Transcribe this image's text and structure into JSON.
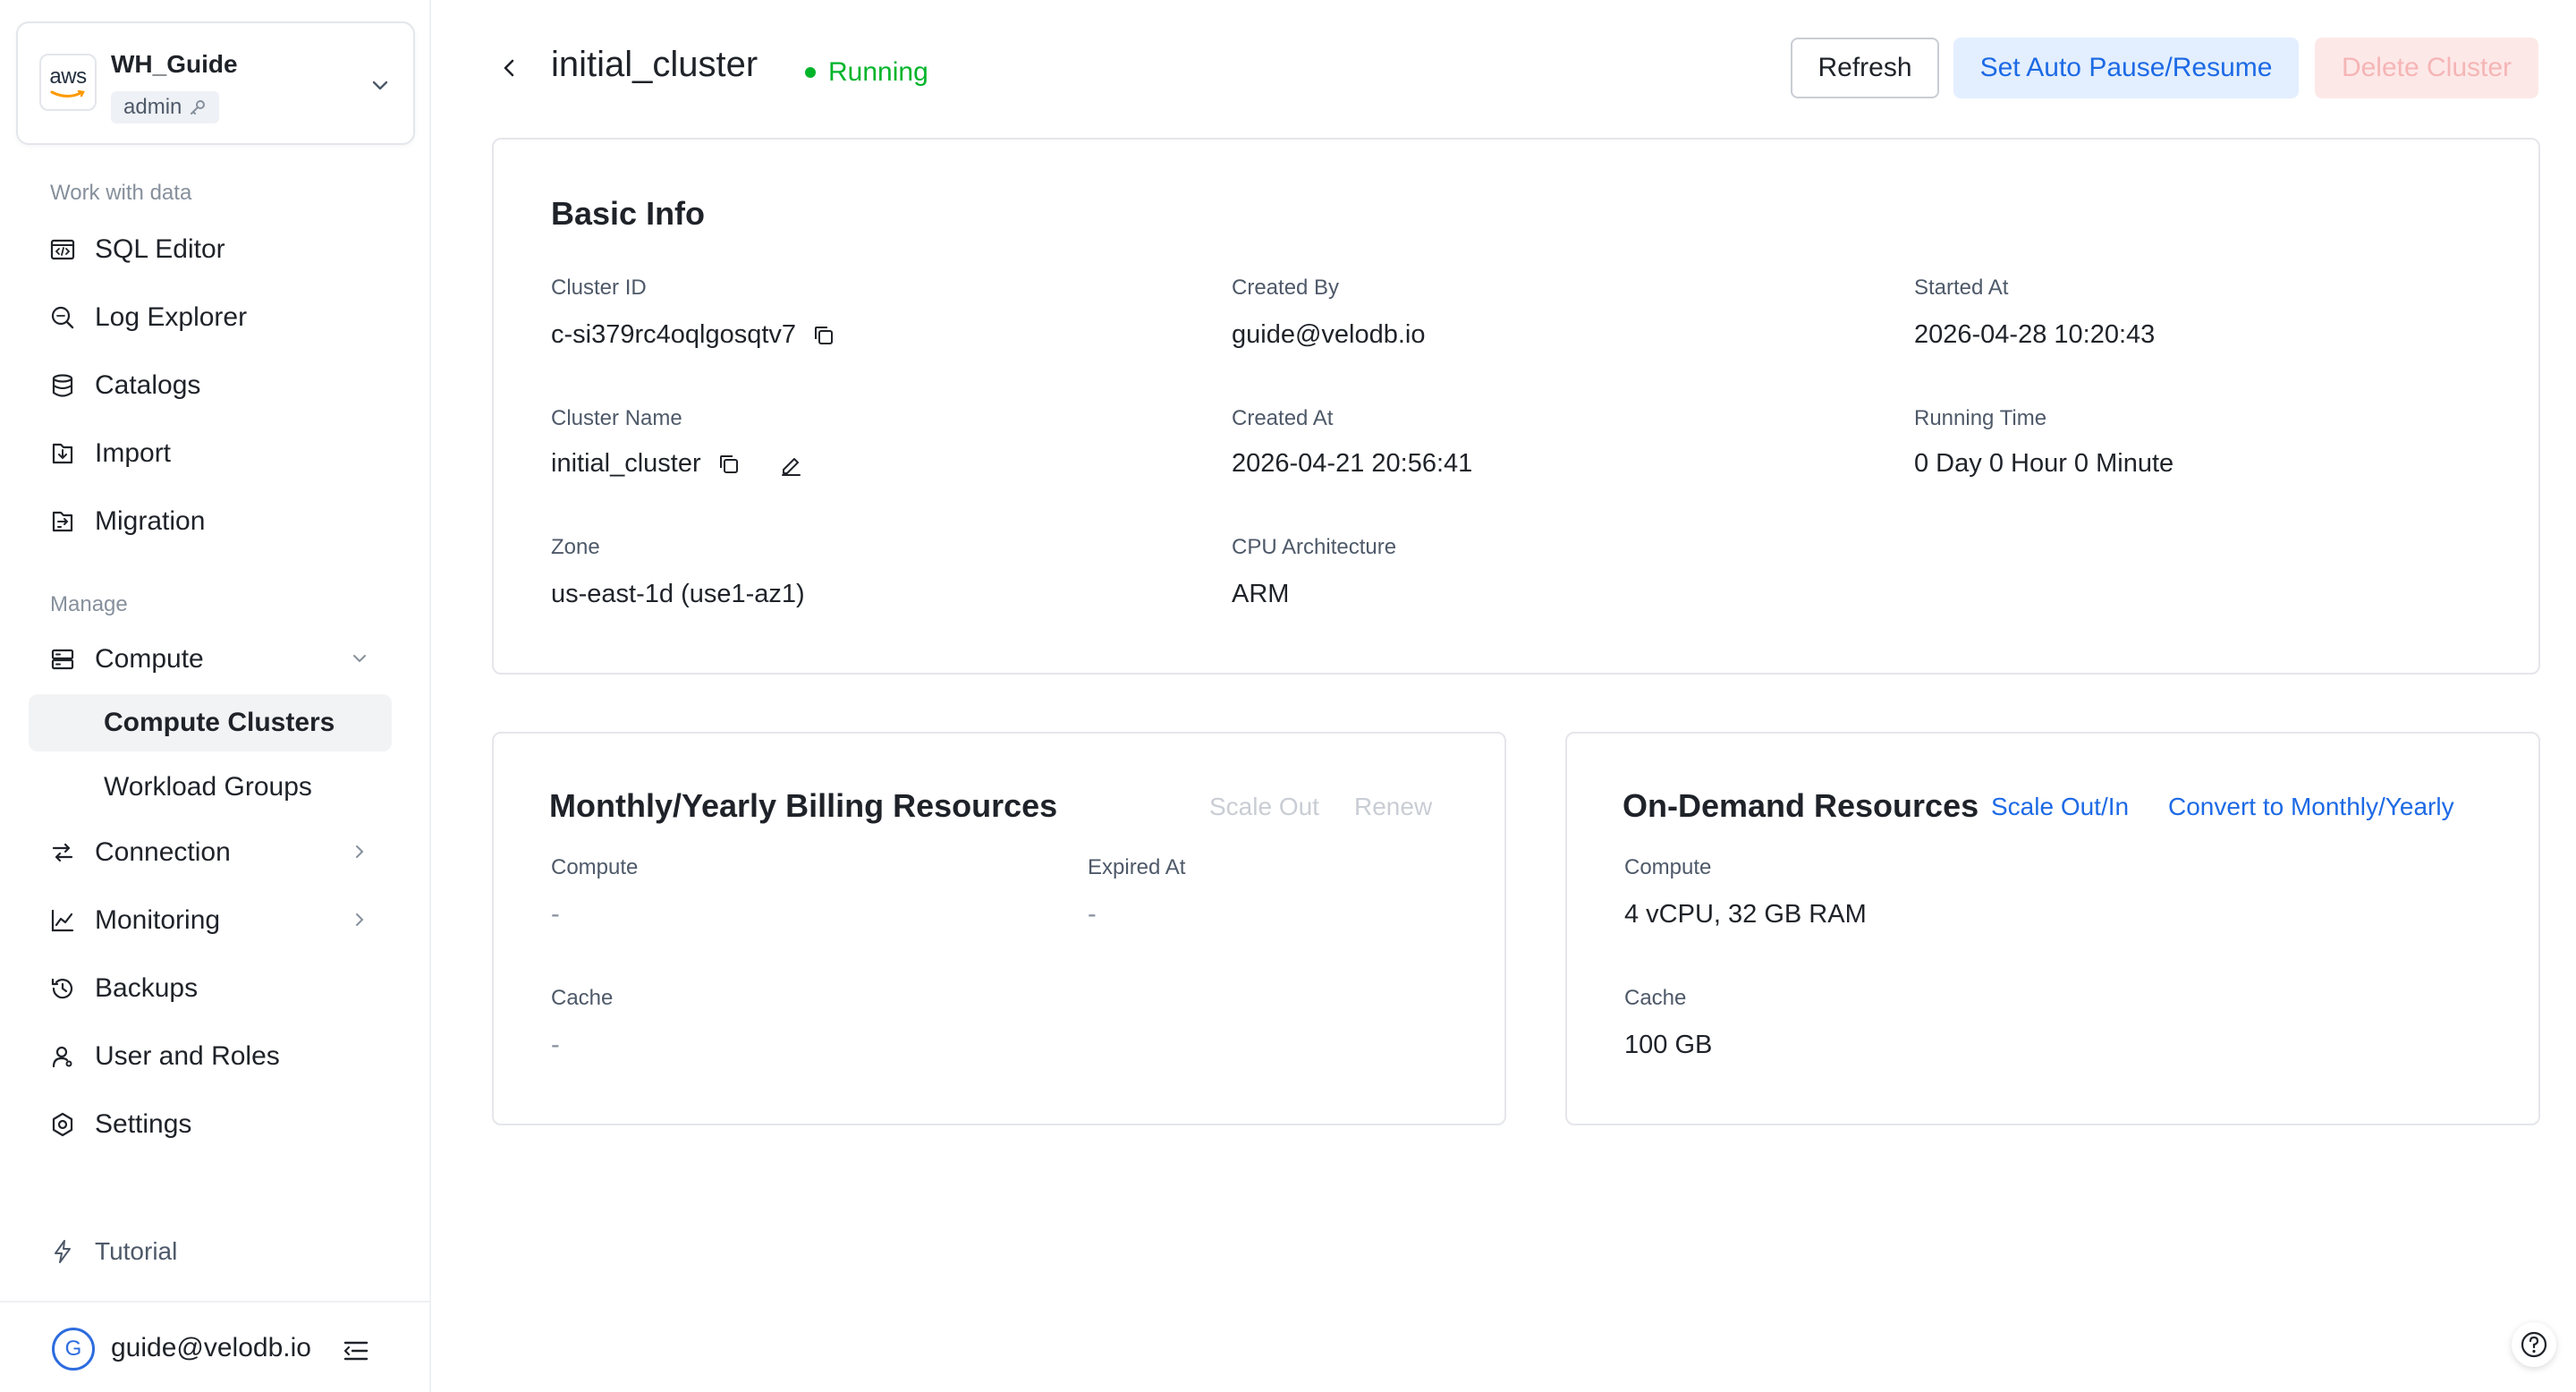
{
  "workspace": {
    "logo_text": "aws",
    "name": "WH_Guide",
    "role": "admin"
  },
  "sidebar": {
    "sections": {
      "work": "Work with data",
      "manage": "Manage"
    },
    "items": {
      "sql_editor": "SQL Editor",
      "log_explorer": "Log Explorer",
      "catalogs": "Catalogs",
      "import": "Import",
      "migration": "Migration",
      "compute": "Compute",
      "compute_clusters": "Compute Clusters",
      "workload_groups": "Workload Groups",
      "connection": "Connection",
      "monitoring": "Monitoring",
      "backups": "Backups",
      "user_roles": "User and Roles",
      "settings": "Settings",
      "tutorial": "Tutorial"
    },
    "user": {
      "avatar_letter": "G",
      "email": "guide@velodb.io"
    }
  },
  "header": {
    "title": "initial_cluster",
    "status": "Running",
    "buttons": {
      "refresh": "Refresh",
      "auto_pause": "Set Auto Pause/Resume",
      "delete": "Delete Cluster"
    }
  },
  "basic_info": {
    "title": "Basic Info",
    "cluster_id_label": "Cluster ID",
    "cluster_id": "c-si379rc4oqlgosqtv7",
    "created_by_label": "Created By",
    "created_by": "guide@velodb.io",
    "started_at_label": "Started At",
    "started_at": "2026-04-28 10:20:43",
    "cluster_name_label": "Cluster Name",
    "cluster_name": "initial_cluster",
    "created_at_label": "Created At",
    "created_at": "2026-04-21 20:56:41",
    "running_time_label": "Running Time",
    "running_time": "0 Day 0 Hour 0 Minute",
    "zone_label": "Zone",
    "zone": "us-east-1d (use1-az1)",
    "cpu_arch_label": "CPU Architecture",
    "cpu_arch": "ARM"
  },
  "billing": {
    "title": "Monthly/Yearly Billing Resources",
    "scale_out": "Scale Out",
    "renew": "Renew",
    "compute_label": "Compute",
    "compute": "-",
    "expired_label": "Expired At",
    "expired": "-",
    "cache_label": "Cache",
    "cache": "-"
  },
  "on_demand": {
    "title": "On-Demand Resources",
    "scale_out_in": "Scale Out/In",
    "convert": "Convert to Monthly/Yearly",
    "compute_label": "Compute",
    "compute": "4 vCPU, 32 GB RAM",
    "cache_label": "Cache",
    "cache": "100 GB"
  },
  "colors": {
    "accent": "#1d6ae5",
    "running": "#00b42a",
    "danger_disabled": "#f5b5b5"
  }
}
